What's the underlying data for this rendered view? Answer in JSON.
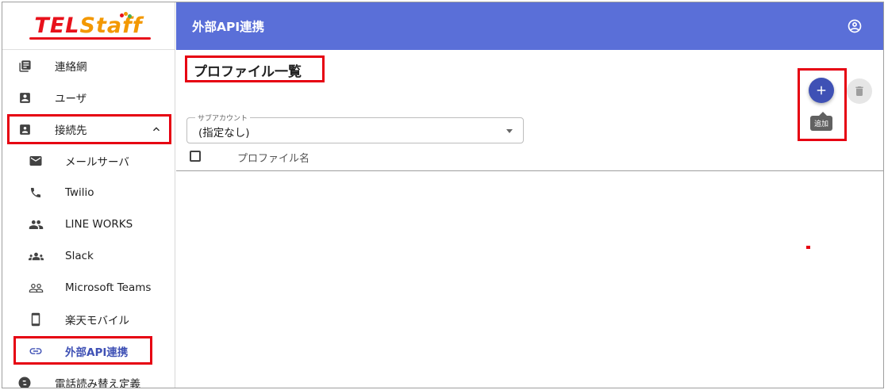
{
  "app": {
    "logo_text_a": "TEL",
    "logo_text_b": "Staff"
  },
  "header": {
    "title": "外部API連携",
    "account_icon": "account-circle-icon"
  },
  "sidebar": {
    "items": [
      {
        "label": "連絡網",
        "icon": "contact-list-icon"
      },
      {
        "label": "ユーザ",
        "icon": "user-icon"
      },
      {
        "label": "接続先",
        "icon": "contact-card-icon",
        "expanded": true
      },
      {
        "label": "メールサーバ",
        "icon": "mail-icon"
      },
      {
        "label": "Twilio",
        "icon": "phone-icon"
      },
      {
        "label": "LINE WORKS",
        "icon": "people-icon"
      },
      {
        "label": "Slack",
        "icon": "groups-icon"
      },
      {
        "label": "Microsoft Teams",
        "icon": "people-outline-icon"
      },
      {
        "label": "楽天モバイル",
        "icon": "smartphone-icon"
      },
      {
        "label": "外部API連携",
        "icon": "link-icon",
        "active": true
      },
      {
        "label": "電話読み替え定義",
        "icon": "phone-swap-icon"
      }
    ]
  },
  "main": {
    "page_title": "プロファイル一覧",
    "add_tooltip": "追加",
    "subaccount": {
      "label": "サブアカウント",
      "value": "(指定なし)"
    },
    "table": {
      "columns": [
        "プロファイル名"
      ],
      "rows": []
    }
  },
  "colors": {
    "topbar": "#5a6fd8",
    "accent": "#3f51b5",
    "highlight": "#e60012"
  }
}
